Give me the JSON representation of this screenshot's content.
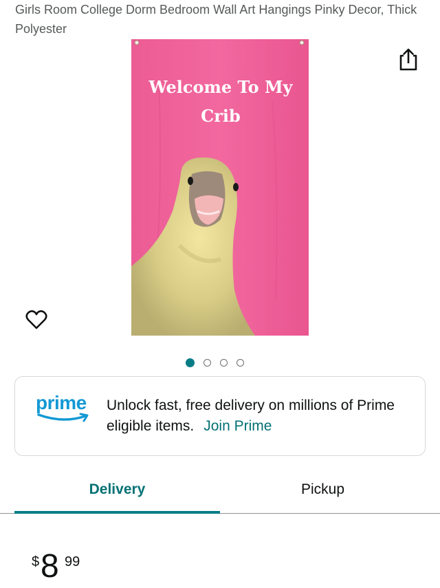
{
  "product": {
    "title": "Girls Room College Dorm Bedroom Wall Art Hangings Pinky Decor, Thick Polyester",
    "image": {
      "banner_line1": "Welcome To My",
      "banner_line2": "Crib",
      "background_color": "#ef5f98"
    },
    "carousel": {
      "total": 4,
      "active_index": 0
    }
  },
  "icons": {
    "share": "share-icon",
    "wishlist": "heart-icon",
    "prime_logo": "prime-logo-icon"
  },
  "prime_banner": {
    "logo_text": "prime",
    "message": "Unlock fast, free delivery on millions of Prime eligible items.",
    "link": "Join Prime"
  },
  "tabs": {
    "delivery": "Delivery",
    "pickup": "Pickup",
    "active": "Delivery"
  },
  "price": {
    "currency": "$",
    "whole": "8",
    "fraction": "99"
  },
  "colors": {
    "accent": "#067d86",
    "link": "#047174",
    "prime_blue": "#1399d4"
  }
}
